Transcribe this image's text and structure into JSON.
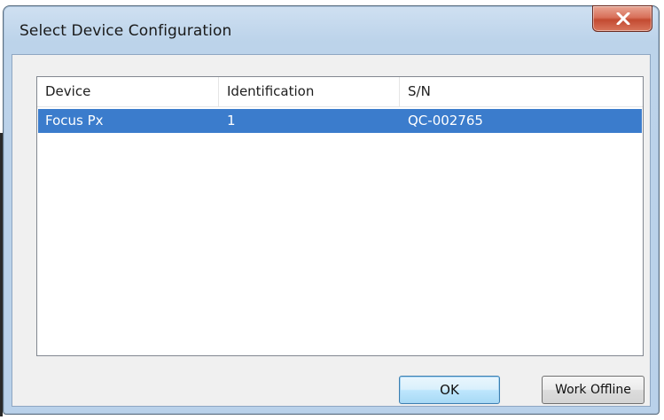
{
  "window": {
    "title": "Select Device Configuration",
    "close_icon": "close-icon",
    "close_symbol": "x"
  },
  "list": {
    "columns": [
      "Device",
      "Identification",
      "S/N"
    ],
    "rows": [
      {
        "device": "Focus Px",
        "identification": "1",
        "sn": "QC-002765",
        "selected": true
      }
    ],
    "selection_color": "#3b7ccc"
  },
  "buttons": {
    "ok_label": "OK",
    "offline_label": "Work Offline"
  },
  "colors": {
    "close_button": "#c34a31",
    "frame": "#b9d1ea"
  }
}
